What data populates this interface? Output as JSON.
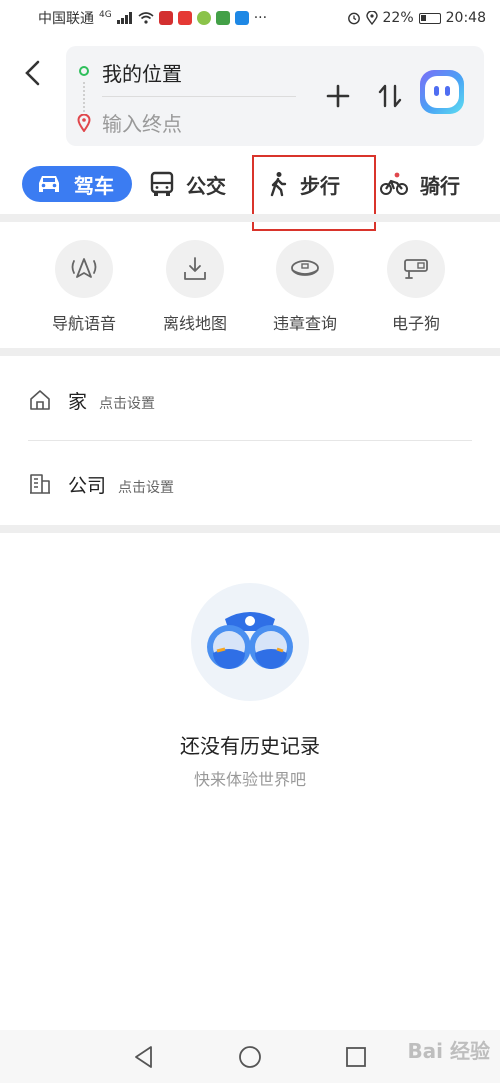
{
  "status_bar": {
    "carrier": "中国联通",
    "network": "4G",
    "battery": "22%",
    "time": "20:48",
    "more": "···"
  },
  "route": {
    "start_label": "我的位置",
    "end_placeholder": "输入终点"
  },
  "modes": [
    {
      "label": "驾车",
      "icon": "car-icon",
      "active": true
    },
    {
      "label": "公交",
      "icon": "bus-icon",
      "active": false
    },
    {
      "label": "步行",
      "icon": "walk-icon",
      "active": false
    },
    {
      "label": "骑行",
      "icon": "bike-icon",
      "active": false
    }
  ],
  "tools": [
    {
      "label": "导航语音",
      "icon": "voice-navigation-icon"
    },
    {
      "label": "离线地图",
      "icon": "offline-map-icon"
    },
    {
      "label": "违章查询",
      "icon": "violation-query-icon"
    },
    {
      "label": "电子狗",
      "icon": "speed-camera-icon"
    }
  ],
  "places": [
    {
      "name": "家",
      "hint": "点击设置",
      "icon": "home-icon"
    },
    {
      "name": "公司",
      "hint": "点击设置",
      "icon": "company-icon"
    }
  ],
  "empty_state": {
    "title": "还没有历史记录",
    "subtitle": "快来体验世界吧"
  },
  "watermark": "Bai 经验",
  "colors": {
    "accent": "#3b7cf2",
    "highlight": "#d9342b",
    "start_dot": "#2fbf5b",
    "end_pin": "#e0474c"
  }
}
